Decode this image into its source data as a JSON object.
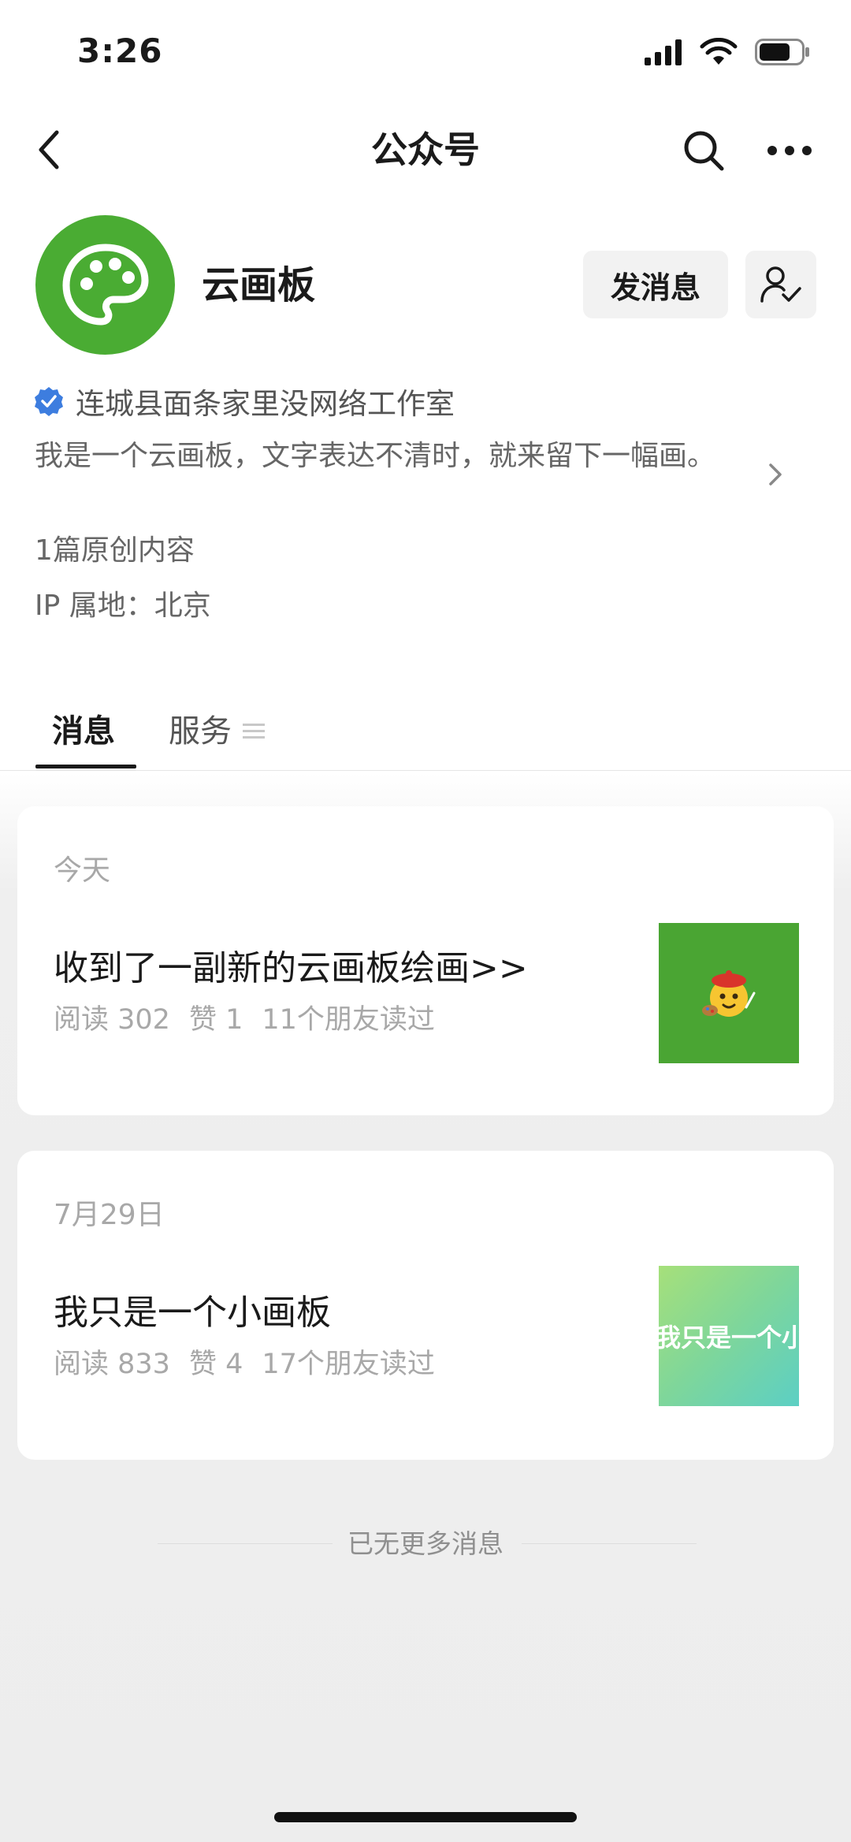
{
  "status_bar": {
    "time": "3:26",
    "icons": [
      "signal-icon",
      "wifi-icon",
      "battery-icon"
    ]
  },
  "nav": {
    "title": "公众号",
    "back_icon": "chevron-left-icon",
    "search_icon": "search-icon",
    "more_icon": "more-icon"
  },
  "profile": {
    "name": "云画板",
    "avatar_icon": "palette-icon",
    "avatar_color": "#4aac33",
    "send_message_label": "发消息",
    "follow_icon": "user-check-icon",
    "verified_icon": "verified-badge-icon",
    "verified_color": "#3d7ddf",
    "verified_name": "连城县面条家里没网络工作室",
    "description": "我是一个云画板，文字表达不清时，就来留下一幅画。",
    "original_count": "1篇原创内容",
    "ip_location": "IP 属地：北京"
  },
  "tabs": {
    "messages": "消息",
    "services": "服务",
    "services_icon": "menu-icon"
  },
  "articles": [
    {
      "date": "今天",
      "title": "收到了一副新的云画板绘画>>",
      "reads": "阅读 302",
      "likes": "赞 1",
      "friends": "11个朋友读过",
      "thumb_color": "#4aa533",
      "thumb_icon": "painter-emoji-icon"
    },
    {
      "date": "7月29日",
      "title": "我只是一个小画板",
      "reads": "阅读 833",
      "likes": "赞 4",
      "friends": "17个朋友读过",
      "thumb_text": "我只是一个小"
    }
  ],
  "footer": {
    "end_text": "已无更多消息"
  }
}
